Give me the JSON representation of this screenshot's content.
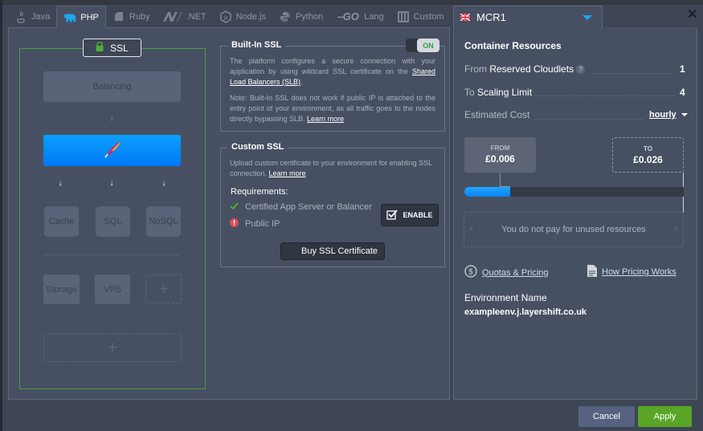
{
  "tabs": [
    {
      "label": "Java",
      "icon": "java-icon",
      "active": false
    },
    {
      "label": "PHP",
      "icon": "php-elephant-icon",
      "active": true
    },
    {
      "label": "Ruby",
      "icon": "ruby-icon",
      "active": false
    },
    {
      "label": ".NET",
      "icon": "dotnet-icon",
      "active": false
    },
    {
      "label": "Node.js",
      "icon": "nodejs-icon",
      "active": false
    },
    {
      "label": "Python",
      "icon": "python-icon",
      "active": false
    },
    {
      "label": "Lang",
      "icon": "go-icon",
      "active": false
    },
    {
      "label": "Custom",
      "icon": "custom-icon",
      "active": false
    }
  ],
  "region": {
    "label": "MCR1",
    "flag": "uk-flag-icon"
  },
  "topology": {
    "ssl_badge": "SSL",
    "balancing": "Balancing",
    "nodes": [
      "Cache",
      "SQL",
      "NoSQL"
    ],
    "extras": [
      "Storage",
      "VPS"
    ],
    "add_symbol": "+"
  },
  "builtin_ssl": {
    "title": "Built-In SSL",
    "toggle": "ON",
    "text1": "The platform configures a secure connection with your application by using wildcard SSL certificate on the ",
    "link1": "Shared Load Balancers (SLB)",
    "text1_end": ".",
    "note": "Note: Built-In SSL does not work if public IP is attached to the entry point of your environment, as all traffic goes to the nodes directly bypassing SLB. ",
    "learn_more": "Learn more"
  },
  "custom_ssl": {
    "title": "Custom SSL",
    "text": "Upload custom certificate to your environment for enabling SSL connection. ",
    "learn_more": "Learn more",
    "requirements_label": "Requirements:",
    "requirements": [
      {
        "label": "Certified App Server or Balancer",
        "status": "ok"
      },
      {
        "label": "Public IP",
        "status": "error"
      }
    ],
    "enable_label": "ENABLE",
    "buy_label": "Buy SSL Certificate"
  },
  "resources": {
    "title": "Container Resources",
    "from_prefix": "From",
    "from_label": "Reserved Cloudlets",
    "from_value": "1",
    "to_prefix": "To",
    "to_label": "Scaling Limit",
    "to_value": "4",
    "cost_label": "Estimated Cost",
    "cost_period": "hourly",
    "from_card_label": "FROM",
    "from_card_value": "£0.006",
    "to_card_label": "TO",
    "to_card_value": "£0.026",
    "progress_fraction": 0.21,
    "notice": "You do not pay for unused resources",
    "quotas_link": "Quotas & Pricing",
    "how_link": "How Pricing Works",
    "env_name_label": "Environment Name",
    "env_name_value": "exampleenv.j.layershift.co.uk"
  },
  "footer": {
    "cancel": "Cancel",
    "apply": "Apply"
  },
  "colors": {
    "accent": "#1ea6f0",
    "apply": "#5aa526",
    "ssl_border": "#4c9a3f",
    "apache": "#0a8cff"
  }
}
